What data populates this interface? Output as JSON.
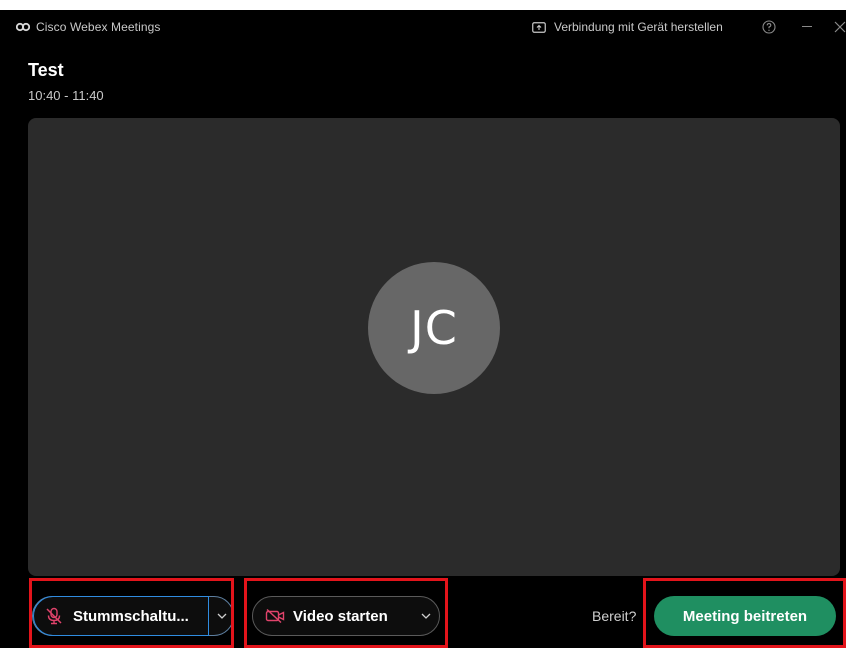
{
  "app": {
    "name": "Cisco Webex Meetings",
    "device_connect_label": "Verbindung mit Gerät herstellen"
  },
  "meeting": {
    "title": "Test",
    "time": "10:40 - 11:40"
  },
  "preview": {
    "avatar_initials": "JC"
  },
  "controls": {
    "mute_label": "Stummschaltu...",
    "video_label": "Video starten",
    "ready_label": "Bereit?",
    "join_label": "Meeting beitreten"
  },
  "colors": {
    "background": "#000000",
    "preview": "#2b2b2b",
    "avatar": "#676767",
    "join_button": "#1f8f61",
    "muted_icon": "#e0436b",
    "highlight": "#e3141b"
  },
  "icons": {
    "app_logo": "webex-logo-icon",
    "device": "device-connect-icon",
    "help": "help-icon",
    "minimize": "minimize-icon",
    "close": "close-icon",
    "mic_off": "mic-off-icon",
    "video_off": "video-off-icon",
    "chevron": "chevron-down-icon"
  }
}
